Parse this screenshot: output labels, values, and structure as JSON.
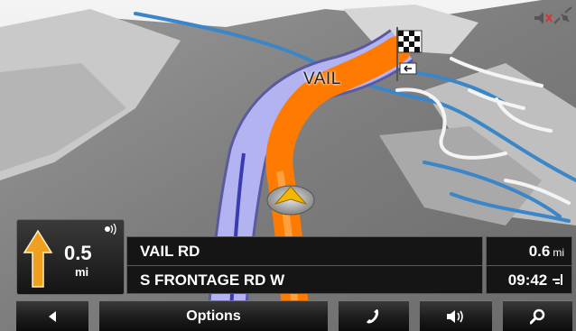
{
  "map": {
    "place_label": "VAIL"
  },
  "maneuver": {
    "distance_value": "0.5",
    "distance_unit": "mi",
    "direction_icon": "arrow-straight-icon"
  },
  "street": {
    "current": "VAIL RD",
    "next": "S FRONTAGE RD W"
  },
  "info": {
    "remaining_distance": "0.6",
    "remaining_unit": "mi",
    "arrival_time": "09:42"
  },
  "toolbar": {
    "back_icon": "back-arrow-icon",
    "options_label": "Options",
    "phone_icon": "phone-icon",
    "volume_icon": "volume-icon",
    "search_icon": "search-icon"
  },
  "status": {
    "mute_icon": "muted-speaker-icon",
    "gps_icon": "satellite-icon"
  },
  "colors": {
    "route": "#ff7a00",
    "road": "#a6a6f0",
    "water": "#3b86c8",
    "terrain": "#8a8a8a"
  }
}
